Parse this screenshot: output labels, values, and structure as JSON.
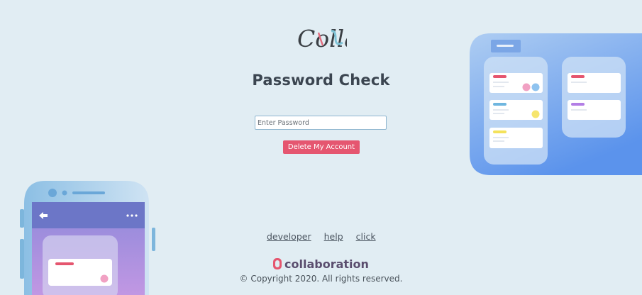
{
  "page": {
    "title": "Password Check"
  },
  "logo": {
    "text": "Colla"
  },
  "form": {
    "password_placeholder": "Enter Password",
    "password_value": "",
    "delete_button_label": "Delete My Account"
  },
  "footer": {
    "links": [
      "developer",
      "help",
      "click"
    ],
    "brand_text": "collaboration",
    "copyright": "© Copyright 2020. All rights reserved."
  },
  "colors": {
    "background": "#e1edf3",
    "accent": "#e55670",
    "input_border": "#8eb6cf"
  },
  "icons": {
    "phone_back": "arrow-left-icon",
    "phone_more": "more-horizontal-icon"
  }
}
